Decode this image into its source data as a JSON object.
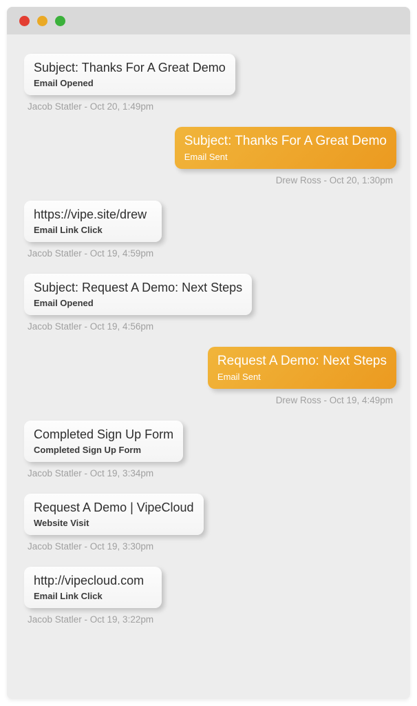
{
  "events": [
    {
      "direction": "left",
      "title": "Subject: Thanks For A Great Demo",
      "subtitle": "Email Opened",
      "meta": "Jacob Statler - Oct 20, 1:49pm"
    },
    {
      "direction": "right",
      "title": "Subject: Thanks For A Great Demo",
      "subtitle": "Email Sent",
      "meta": "Drew Ross - Oct 20, 1:30pm"
    },
    {
      "direction": "left",
      "title": "https://vipe.site/drew",
      "subtitle": "Email Link Click",
      "meta": "Jacob Statler - Oct 19, 4:59pm"
    },
    {
      "direction": "left",
      "title": "Subject: Request A Demo: Next Steps",
      "subtitle": "Email Opened",
      "meta": "Jacob Statler - Oct 19, 4:56pm"
    },
    {
      "direction": "right",
      "title": "Request A Demo: Next Steps",
      "subtitle": "Email Sent",
      "meta": "Drew Ross - Oct 19, 4:49pm"
    },
    {
      "direction": "left",
      "title": "Completed Sign Up Form",
      "subtitle": "Completed Sign Up Form",
      "meta": "Jacob Statler - Oct 19, 3:34pm"
    },
    {
      "direction": "left",
      "title": "Request A Demo | VipeCloud",
      "subtitle": "Website Visit",
      "meta": "Jacob Statler - Oct 19, 3:30pm"
    },
    {
      "direction": "left",
      "title": "http://vipecloud.com",
      "subtitle": "Email Link Click",
      "meta": "Jacob Statler - Oct 19, 3:22pm"
    }
  ]
}
